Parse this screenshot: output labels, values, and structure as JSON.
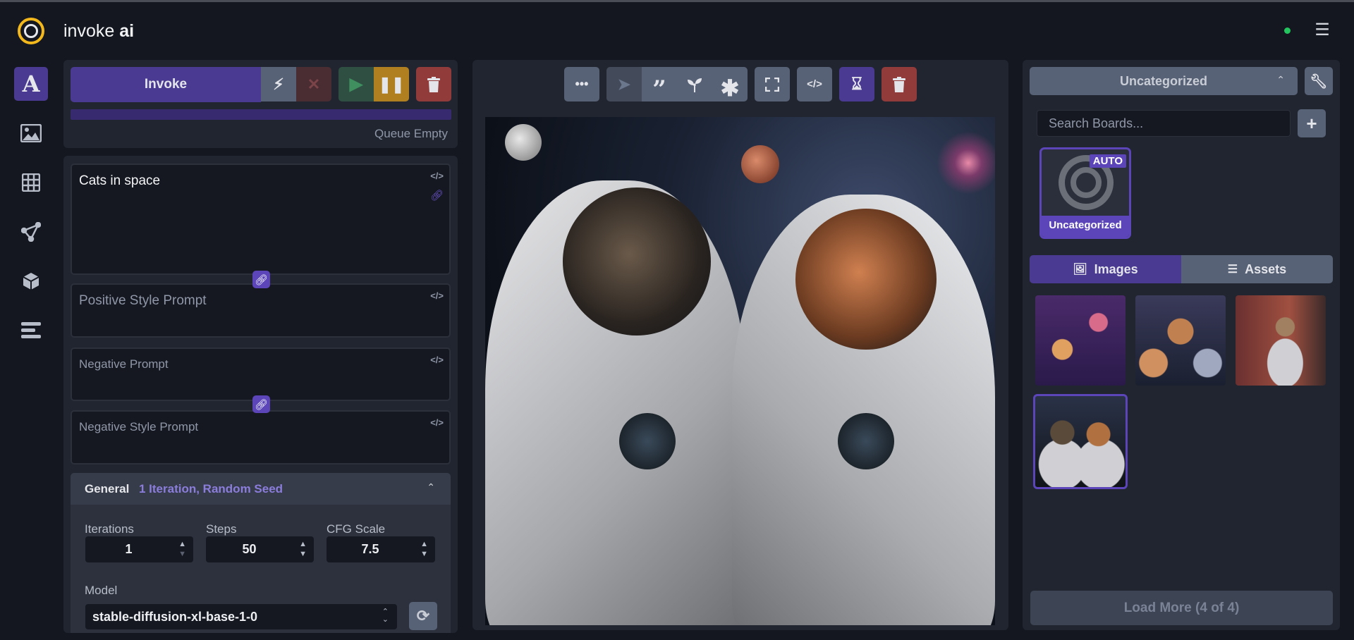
{
  "app": {
    "title_regular": "invoke ",
    "title_bold": "ai",
    "status_color": "#22c55e"
  },
  "sidebar": {
    "items": [
      {
        "name": "text-to-image",
        "icon": "letter-a-icon",
        "active": true
      },
      {
        "name": "image-to-image",
        "icon": "image-icon"
      },
      {
        "name": "unified-canvas",
        "icon": "grid-icon"
      },
      {
        "name": "workflow-editor",
        "icon": "nodes-icon"
      },
      {
        "name": "model-manager",
        "icon": "cube-icon"
      },
      {
        "name": "queue",
        "icon": "list-icon"
      }
    ]
  },
  "queue": {
    "invoke_label": "Invoke",
    "status": "Queue Empty",
    "colors": {
      "accent": "#4b3a92",
      "resume": "#2f4f43",
      "pause": "#b07f1f",
      "clear": "#913b3b"
    }
  },
  "prompts": {
    "positive": "Cats in space",
    "positive_style_placeholder": "Positive Style Prompt",
    "negative_placeholder": "Negative Prompt",
    "negative_style_placeholder": "Negative Style Prompt",
    "code_icon": "</>"
  },
  "general": {
    "title": "General",
    "summary": "1 Iteration, Random Seed",
    "iterations_label": "Iterations",
    "iterations": "1",
    "steps_label": "Steps",
    "steps": "50",
    "cfg_label": "CFG Scale",
    "cfg": "7.5",
    "model_label": "Model",
    "model": "stable-diffusion-xl-base-1-0"
  },
  "viewer": {
    "toolbar": [
      "more-icon",
      "workflow-icon",
      "quote-icon",
      "seed-icon",
      "asterisk-icon",
      "fullscreen-icon",
      "code-icon",
      "hourglass-icon",
      "trash-icon"
    ]
  },
  "gallery": {
    "board_selected": "Uncategorized",
    "search_placeholder": "Search Boards...",
    "board": {
      "name": "Uncategorized",
      "badge": "AUTO"
    },
    "tabs": {
      "images": "Images",
      "assets": "Assets"
    },
    "load_more": "Load More (4 of 4)"
  }
}
